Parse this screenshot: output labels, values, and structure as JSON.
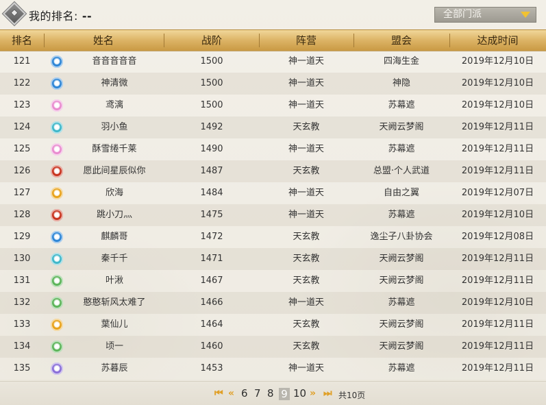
{
  "my_rank": {
    "label": "我的排名:",
    "value": "--"
  },
  "filter": {
    "selected": "全部门派"
  },
  "columns": [
    "排名",
    "姓名",
    "战阶",
    "阵营",
    "盟会",
    "达成时间"
  ],
  "rows": [
    {
      "rank": "121",
      "name": "音音音音音",
      "power": "1500",
      "camp": "神一道天",
      "guild": "四海生金",
      "date": "2019年12月10日",
      "sect_color": "#2e86d6"
    },
    {
      "rank": "122",
      "name": "神清微",
      "power": "1500",
      "camp": "神一道天",
      "guild": "神隐",
      "date": "2019年12月10日",
      "sect_color": "#2e86d6"
    },
    {
      "rank": "123",
      "name": "鸢漓",
      "power": "1500",
      "camp": "神一道天",
      "guild": "苏幕遮",
      "date": "2019年12月10日",
      "sect_color": "#e98ccf"
    },
    {
      "rank": "124",
      "name": "羽小鱼",
      "power": "1492",
      "camp": "天玄教",
      "guild": "天阙云梦阁",
      "date": "2019年12月11日",
      "sect_color": "#3fb7c9"
    },
    {
      "rank": "125",
      "name": "酥雪绻千莱",
      "power": "1490",
      "camp": "神一道天",
      "guild": "苏幕遮",
      "date": "2019年12月11日",
      "sect_color": "#e98ccf"
    },
    {
      "rank": "126",
      "name": "愿此间星辰似你",
      "power": "1487",
      "camp": "天玄教",
      "guild": "总盟·个人武道",
      "date": "2019年12月11日",
      "sect_color": "#c8341f"
    },
    {
      "rank": "127",
      "name": "欣海",
      "power": "1484",
      "camp": "神一道天",
      "guild": "自由之翼",
      "date": "2019年12月07日",
      "sect_color": "#e8a31c"
    },
    {
      "rank": "128",
      "name": "跳小刀灬",
      "power": "1475",
      "camp": "神一道天",
      "guild": "苏幕遮",
      "date": "2019年12月10日",
      "sect_color": "#c8341f"
    },
    {
      "rank": "129",
      "name": "麒麟哥",
      "power": "1472",
      "camp": "天玄教",
      "guild": "逸尘子八卦协会",
      "date": "2019年12月08日",
      "sect_color": "#2e86d6"
    },
    {
      "rank": "130",
      "name": "秦千千",
      "power": "1471",
      "camp": "天玄教",
      "guild": "天阙云梦阁",
      "date": "2019年12月11日",
      "sect_color": "#3fb7c9"
    },
    {
      "rank": "131",
      "name": "叶湫",
      "power": "1467",
      "camp": "天玄教",
      "guild": "天阙云梦阁",
      "date": "2019年12月11日",
      "sect_color": "#5db55a"
    },
    {
      "rank": "132",
      "name": "憨憨斩风太难了",
      "power": "1466",
      "camp": "神一道天",
      "guild": "苏幕遮",
      "date": "2019年12月10日",
      "sect_color": "#5db55a"
    },
    {
      "rank": "133",
      "name": "葉仙儿",
      "power": "1464",
      "camp": "天玄教",
      "guild": "天阙云梦阁",
      "date": "2019年12月11日",
      "sect_color": "#e8a31c"
    },
    {
      "rank": "134",
      "name": "顷一",
      "power": "1460",
      "camp": "天玄教",
      "guild": "天阙云梦阁",
      "date": "2019年12月11日",
      "sect_color": "#5db55a"
    },
    {
      "rank": "135",
      "name": "苏暮辰",
      "power": "1453",
      "camp": "神一道天",
      "guild": "苏幕遮",
      "date": "2019年12月11日",
      "sect_color": "#8a6fd8"
    }
  ],
  "pager": {
    "first_icon": "first-page-icon",
    "prev_icon": "prev-page-icon",
    "next_icon": "next-page-icon",
    "last_icon": "last-page-icon",
    "pages": [
      "6",
      "7",
      "8",
      "9",
      "10"
    ],
    "current": "9",
    "total": "共10页"
  }
}
